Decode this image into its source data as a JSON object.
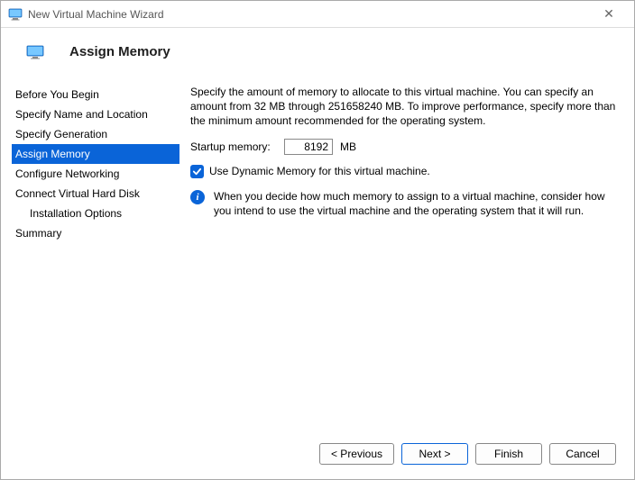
{
  "window": {
    "title": "New Virtual Machine Wizard"
  },
  "header": {
    "title": "Assign Memory"
  },
  "sidebar": {
    "steps": [
      "Before You Begin",
      "Specify Name and Location",
      "Specify Generation",
      "Assign Memory",
      "Configure Networking",
      "Connect Virtual Hard Disk",
      "Installation Options",
      "Summary"
    ]
  },
  "content": {
    "description": "Specify the amount of memory to allocate to this virtual machine. You can specify an amount from 32 MB through 251658240 MB. To improve performance, specify more than the minimum amount recommended for the operating system.",
    "startup_label": "Startup memory:",
    "startup_value": "8192",
    "startup_unit": "MB",
    "dynamic_label": "Use Dynamic Memory for this virtual machine.",
    "info_text": "When you decide how much memory to assign to a virtual machine, consider how you intend to use the virtual machine and the operating system that it will run."
  },
  "footer": {
    "previous": "< Previous",
    "next": "Next >",
    "finish": "Finish",
    "cancel": "Cancel"
  }
}
